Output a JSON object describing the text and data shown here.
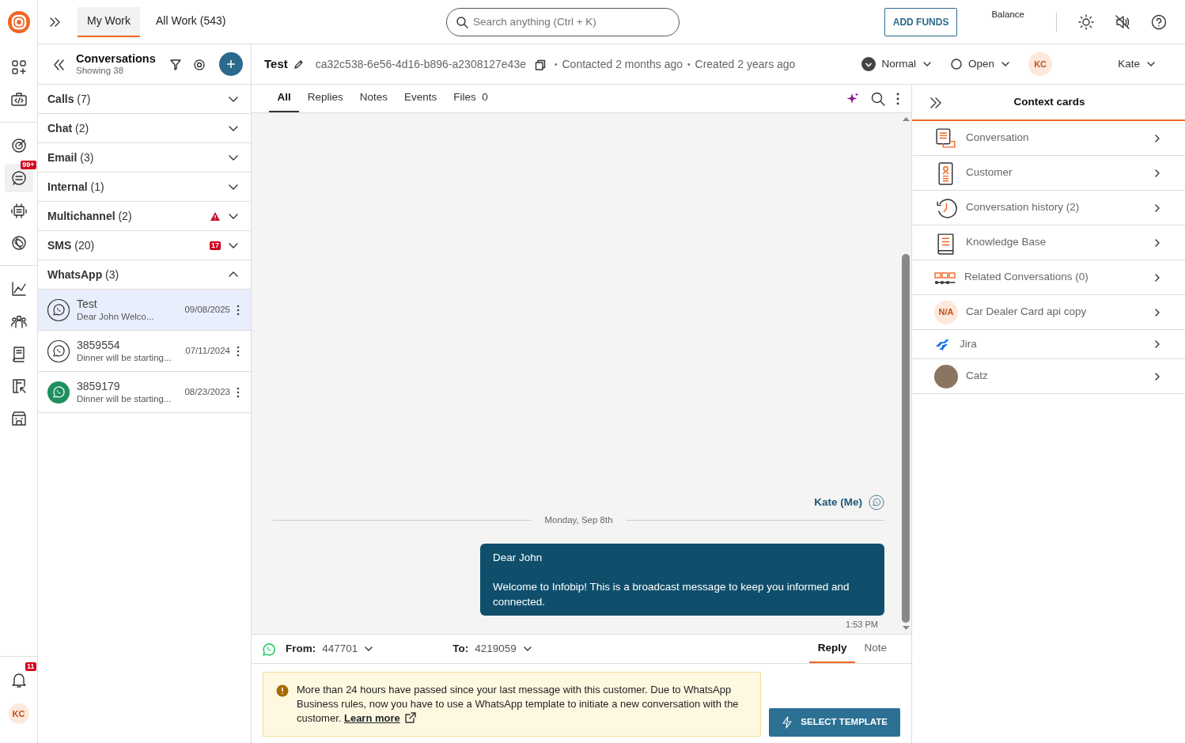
{
  "topbar": {
    "tabs": [
      {
        "label": "My Work",
        "selected": true
      },
      {
        "label": "All Work (543)",
        "selected": false
      }
    ],
    "search": {
      "placeholder": "Search anything (Ctrl + K)"
    },
    "add_funds": "ADD FUNDS",
    "balance_label": "Balance"
  },
  "rail": {
    "sections": [
      {
        "items": [
          {
            "kind": "apps",
            "selected": false
          },
          {
            "kind": "code",
            "selected": false
          }
        ]
      },
      {
        "items": [
          {
            "kind": "target",
            "selected": false
          },
          {
            "kind": "chat",
            "selected": true,
            "badge": "99+"
          },
          {
            "kind": "bot",
            "selected": false
          },
          {
            "kind": "ai",
            "selected": false
          }
        ]
      },
      {
        "items": [
          {
            "kind": "chart",
            "selected": false
          },
          {
            "kind": "people",
            "selected": false
          },
          {
            "kind": "book",
            "selected": false
          },
          {
            "kind": "report",
            "selected": false
          },
          {
            "kind": "store",
            "selected": false
          }
        ]
      }
    ],
    "notifications_badge": "11",
    "avatar": "KC"
  },
  "conversations": {
    "title": "Conversations",
    "subtitle": "Showing 38",
    "groups": [
      {
        "label": "Calls",
        "count": "(7)",
        "expanded": false
      },
      {
        "label": "Chat",
        "count": "(2)",
        "expanded": false
      },
      {
        "label": "Email",
        "count": "(3)",
        "expanded": false
      },
      {
        "label": "Internal",
        "count": "(1)",
        "expanded": false
      },
      {
        "label": "Multichannel",
        "count": "(2)",
        "expanded": false,
        "alert": true
      },
      {
        "label": "SMS",
        "count": "(20)",
        "expanded": false,
        "badge": "17"
      },
      {
        "label": "WhatsApp",
        "count": "(3)",
        "expanded": true,
        "items": [
          {
            "title": "Test",
            "preview": "Dear John Welco...",
            "date": "09/08/2025",
            "selected": true,
            "active": false
          },
          {
            "title": "3859554",
            "preview": "Dinner will be starting...",
            "date": "07/11/2024",
            "selected": false,
            "active": false
          },
          {
            "title": "3859179",
            "preview": "Dinner will be starting...",
            "date": "08/23/2023",
            "selected": false,
            "active": true
          }
        ]
      }
    ]
  },
  "conversation": {
    "title": "Test",
    "id": "ca32c538-6e56-4d16-b896-a2308127e43e",
    "separator": "•",
    "contacted": "Contacted 2 months ago",
    "created": "Created 2 years ago",
    "priority": "Normal",
    "status": "Open",
    "assignee_initials": "KC",
    "assignee": "Kate",
    "tabs": [
      {
        "label": "All",
        "selected": true
      },
      {
        "label": "Replies",
        "selected": false
      },
      {
        "label": "Notes",
        "selected": false
      },
      {
        "label": "Events",
        "selected": false
      },
      {
        "label": "Files",
        "count": "0",
        "selected": false
      }
    ],
    "sender": "Kate (Me)",
    "date_divider": "Monday, Sep 8th",
    "message": {
      "paragraphs": [
        "Dear John",
        "Welcome to Infobip! This is a broadcast message to keep you informed and connected."
      ],
      "time": "1:53 PM"
    },
    "composer": {
      "from_label": "From:",
      "from": "447701",
      "to_label": "To:",
      "to": "4219059",
      "modes": [
        {
          "label": "Reply",
          "selected": true
        },
        {
          "label": "Note",
          "selected": false
        }
      ],
      "warning": "More than 24 hours have passed since your last message with this customer. Due to WhatsApp Business rules, now you have to use a WhatsApp template to initiate a new conversation with the customer.",
      "link": "Learn more",
      "button": "SELECT TEMPLATE"
    }
  },
  "context": {
    "title": "Context cards",
    "cards": [
      {
        "kind": "conversation",
        "label": "Conversation"
      },
      {
        "kind": "customer",
        "label": "Customer"
      },
      {
        "kind": "history",
        "label": "Conversation history (2)"
      },
      {
        "kind": "knowledge",
        "label": "Knowledge Base"
      },
      {
        "kind": "related",
        "label": "Related Conversations (0)"
      },
      {
        "kind": "initials",
        "initials": "N/A",
        "label": "Car Dealer Card api copy"
      },
      {
        "kind": "jira",
        "label": "Jira"
      },
      {
        "kind": "photo",
        "label": "Catz"
      }
    ]
  }
}
